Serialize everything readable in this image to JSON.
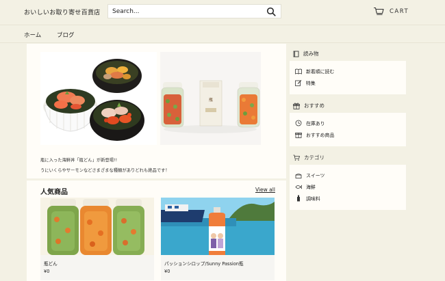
{
  "header": {
    "store_name": "おいしいお取り寄せ百貨店",
    "search_placeholder": "Search...",
    "cart_label": "CART"
  },
  "nav": {
    "items": [
      {
        "label": "ホーム"
      },
      {
        "label": "ブログ"
      }
    ]
  },
  "main": {
    "caption_line1": "瓶に入った海鮮丼「瓶どん」が新登場!!",
    "caption_line2": "うにいくらやサーモンなどさまざまな種類がありどれも絶品です！",
    "section_title": "人気商品",
    "view_all": "View all",
    "products": [
      {
        "name": "瓶どん",
        "price": "¥0"
      },
      {
        "name": "パッションシロップ/Sunny Passion瓶",
        "price": "¥0"
      }
    ]
  },
  "sidebar": {
    "sections": [
      {
        "title": "読み物",
        "icon": "book-icon",
        "items": [
          {
            "label": "新着順に読む",
            "icon": "open-book-icon"
          },
          {
            "label": "特集",
            "icon": "edit-icon"
          }
        ]
      },
      {
        "title": "おすすめ",
        "icon": "gift-icon",
        "items": [
          {
            "label": "在庫あり",
            "icon": "clock-icon"
          },
          {
            "label": "おすすめ商品",
            "icon": "gift-icon"
          }
        ]
      },
      {
        "title": "カテゴリ",
        "icon": "cart-icon",
        "items": [
          {
            "label": "スイーツ",
            "icon": "cake-icon"
          },
          {
            "label": "海鮮",
            "icon": "fish-icon"
          },
          {
            "label": "調味料",
            "icon": "bottle-icon"
          }
        ]
      }
    ]
  }
}
